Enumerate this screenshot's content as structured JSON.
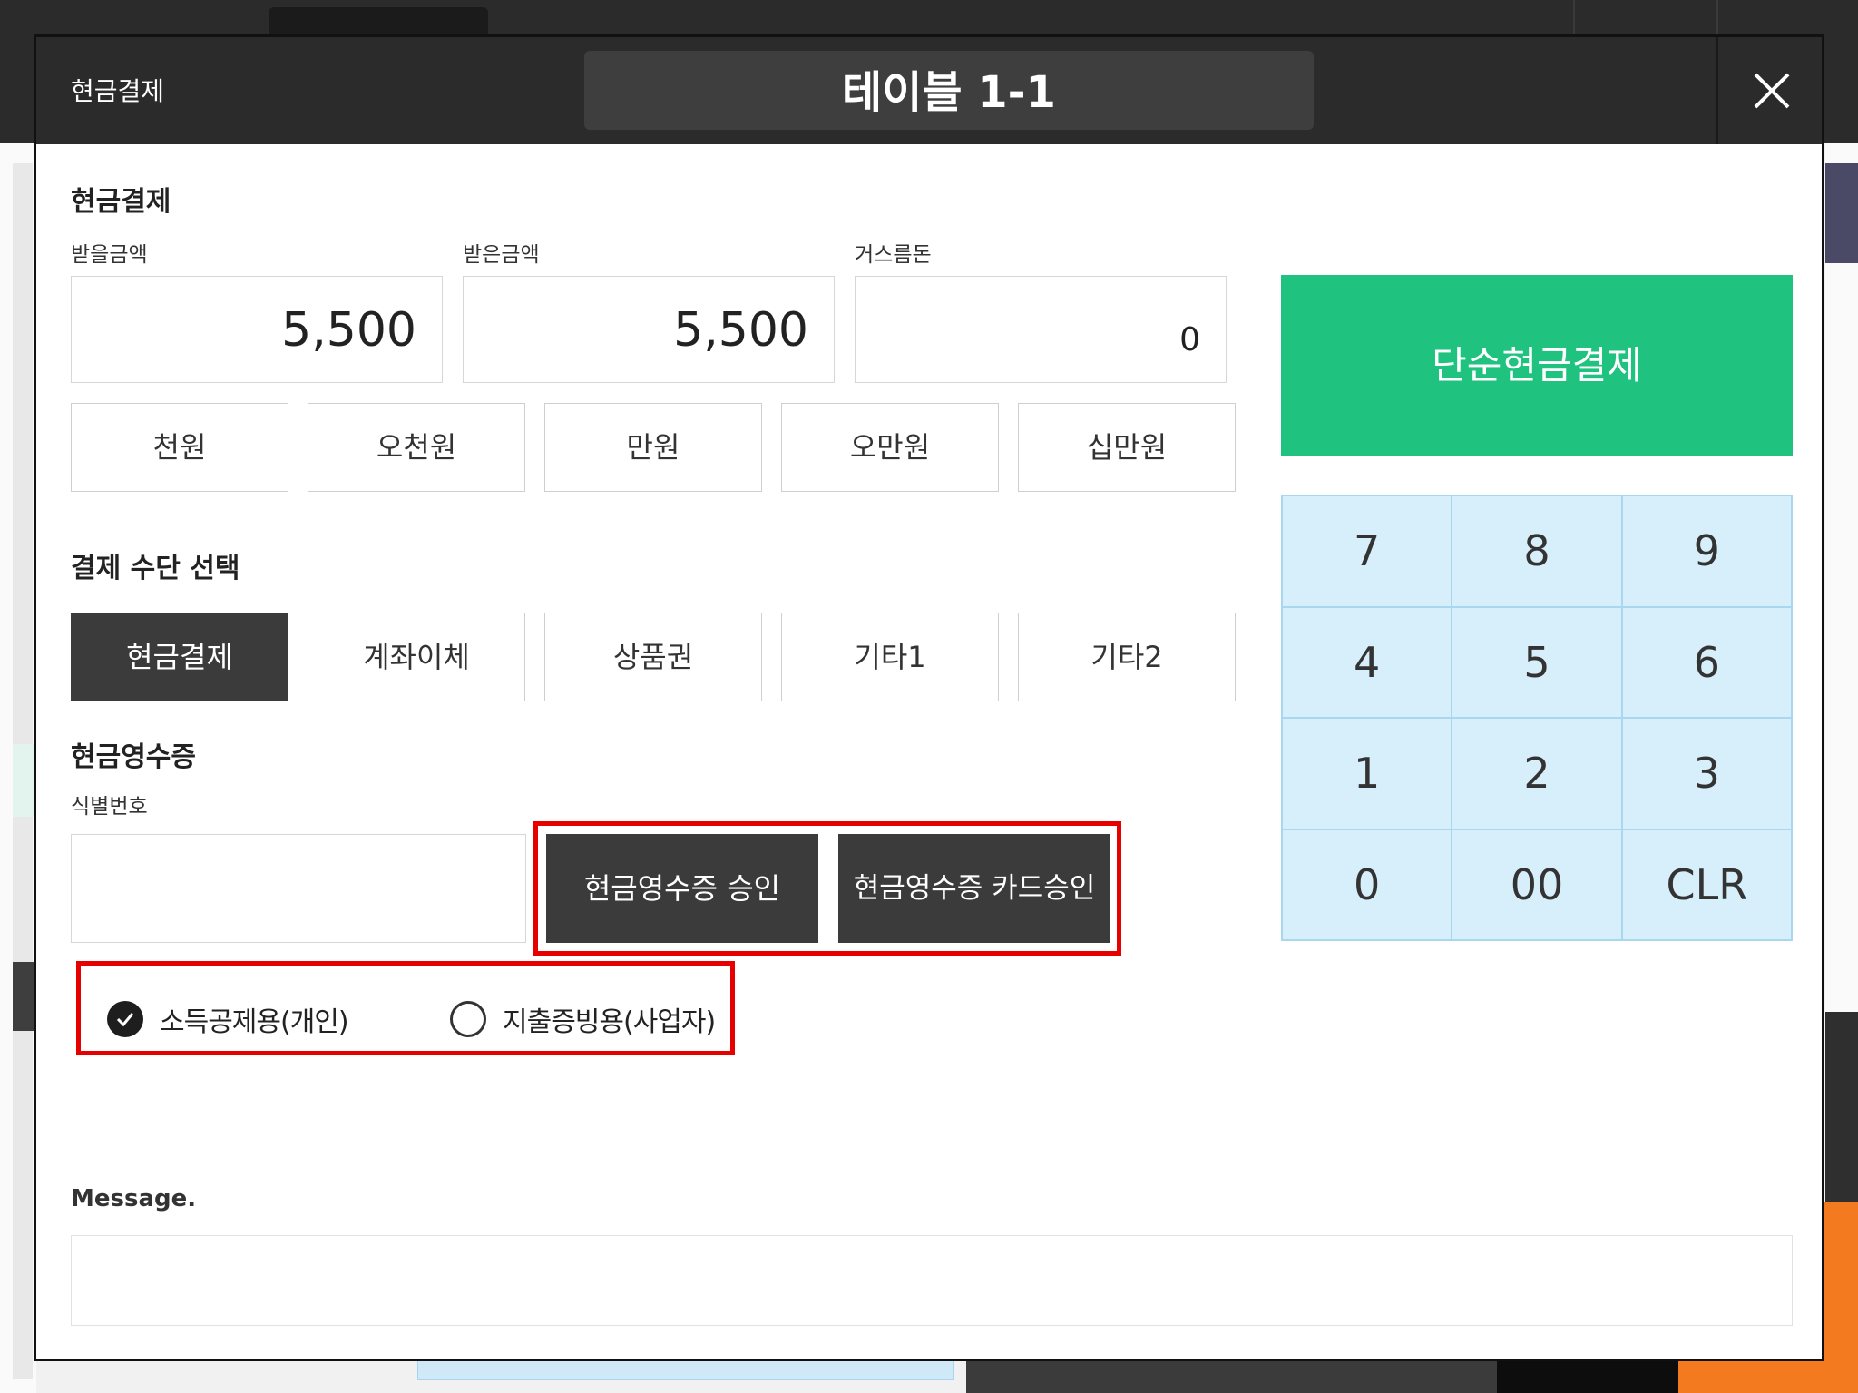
{
  "header": {
    "title": "현금결제",
    "table_name": "테이블 1-1",
    "close_icon": "close-icon"
  },
  "cash_section": {
    "title": "현금결제",
    "labels": {
      "to_receive": "받을금액",
      "received": "받은금액",
      "change": "거스름돈"
    },
    "values": {
      "to_receive": "5,500",
      "received": "5,500",
      "change": "0"
    },
    "quick_amounts": [
      "천원",
      "오천원",
      "만원",
      "오만원",
      "십만원"
    ]
  },
  "payment_method": {
    "title": "결제 수단 선택",
    "options": [
      "현금결제",
      "계좌이체",
      "상품권",
      "기타1",
      "기타2"
    ],
    "selected": "현금결제"
  },
  "receipt": {
    "title": "현금영수증",
    "id_label": "식별번호",
    "id_value": "",
    "approve_button": "현금영수증 승인",
    "card_approve_button": "현금영수증 카드승인",
    "radio_options": [
      "소득공제용(개인)",
      "지출증빙용(사업자)"
    ],
    "radio_selected": "소득공제용(개인)"
  },
  "simple_cash_button": "단순현금결제",
  "keypad": [
    "7",
    "8",
    "9",
    "4",
    "5",
    "6",
    "1",
    "2",
    "3",
    "0",
    "00",
    "CLR"
  ],
  "message": {
    "label": "Message.",
    "value": ""
  },
  "colors": {
    "green": "#1fc27f",
    "keypad_bg": "#d7eefb",
    "dark": "#3b3b3b",
    "highlight_red": "#e60000"
  }
}
